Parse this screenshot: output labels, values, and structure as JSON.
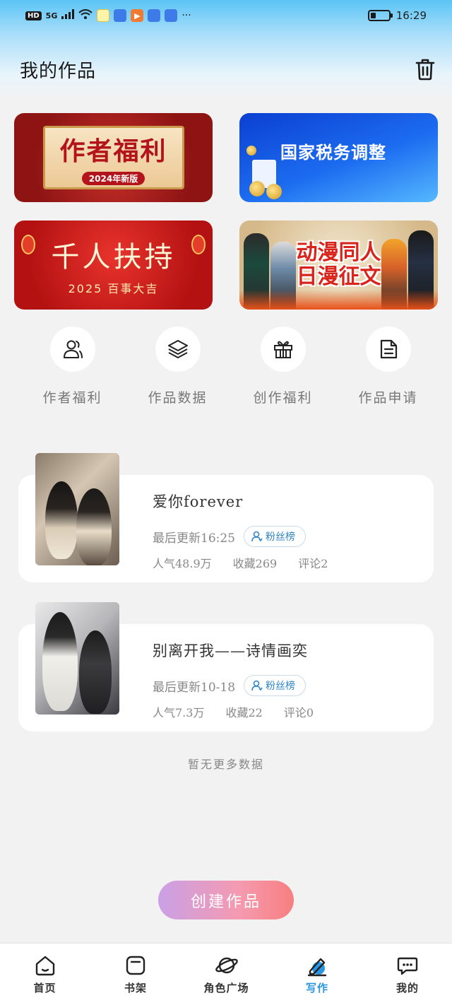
{
  "status_bar": {
    "network": "HD",
    "signal": "5G",
    "more": "···",
    "battery_level": 0.3,
    "time": "16:29"
  },
  "header": {
    "title": "我的作品",
    "delete_icon": "trash-icon"
  },
  "banners": [
    {
      "title": "作者福利",
      "tag": "2024年新版"
    },
    {
      "title": "国家税务调整"
    },
    {
      "title": "千人扶持",
      "subtitle": "2025 百事大吉"
    },
    {
      "title_line1": "动漫同人",
      "title_line2": "日漫征文"
    }
  ],
  "quick_links": [
    {
      "label": "作者福利",
      "icon": "users-icon"
    },
    {
      "label": "作品数据",
      "icon": "layers-icon"
    },
    {
      "label": "创作福利",
      "icon": "gift-icon"
    },
    {
      "label": "作品申请",
      "icon": "document-icon"
    }
  ],
  "works": [
    {
      "title": "爱你forever",
      "updated": "最后更新16:25",
      "badge": "粉丝榜",
      "popularity": "人气48.9万",
      "favorites": "收藏269",
      "comments": "评论2"
    },
    {
      "title": "别离开我——诗情画奕",
      "updated": "最后更新10-18",
      "badge": "粉丝榜",
      "popularity": "人气7.3万",
      "favorites": "收藏22",
      "comments": "评论0"
    }
  ],
  "empty_text": "暂无更多数据",
  "create_button": "创建作品",
  "bottom_nav": [
    {
      "label": "首页",
      "icon": "home-icon"
    },
    {
      "label": "书架",
      "icon": "bookshelf-icon"
    },
    {
      "label": "角色广场",
      "icon": "planet-icon"
    },
    {
      "label": "写作",
      "icon": "pen-icon",
      "active": true
    },
    {
      "label": "我的",
      "icon": "chat-icon"
    }
  ],
  "colors": {
    "accent": "#2a95e0",
    "badge_text": "#2f86c6",
    "create_gradient_start": "#c9a0e6",
    "create_gradient_end": "#f77f7f"
  }
}
